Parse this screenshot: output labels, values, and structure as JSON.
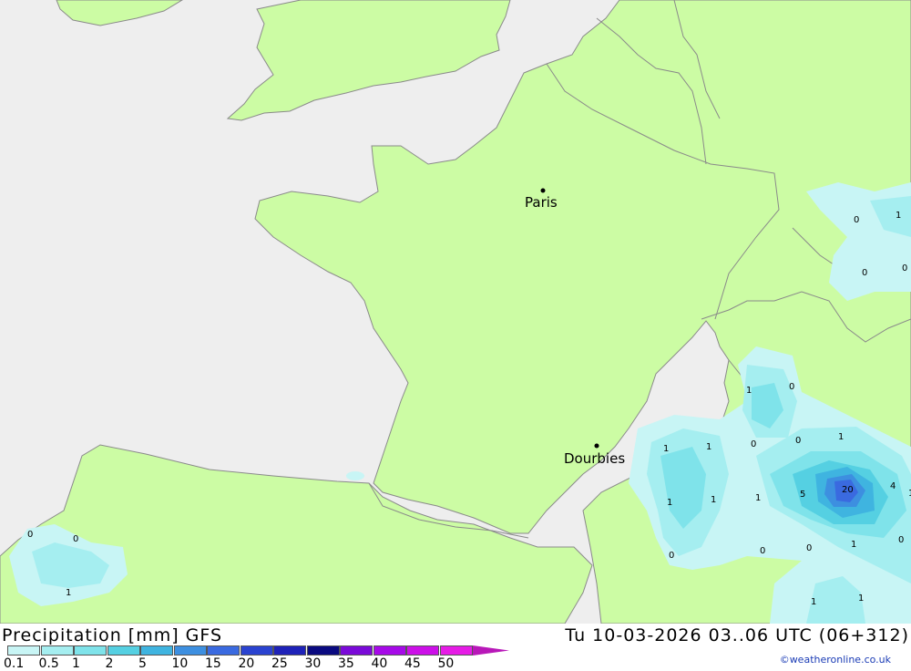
{
  "map": {
    "cities": [
      {
        "name": "Paris"
      },
      {
        "name": "Dourbies"
      }
    ],
    "values": [
      "1",
      "0",
      "0",
      "0",
      "1",
      "0",
      "0",
      "1",
      "1",
      "0",
      "1",
      "1",
      "1",
      "1",
      "1",
      "5",
      "20",
      "4",
      "0",
      "0",
      "1",
      "0",
      "0",
      "0",
      "0",
      "1",
      "1",
      "1"
    ]
  },
  "footer": {
    "title": "Precipitation [mm] GFS",
    "datetime": "Tu 10-03-2026 03..06 UTC (06+312)",
    "credit": "©weatheronline.co.uk"
  },
  "legend": {
    "labels": [
      "0.1",
      "0.5",
      "1",
      "2",
      "5",
      "10",
      "15",
      "20",
      "25",
      "30",
      "35",
      "40",
      "45",
      "50"
    ],
    "colors": [
      "#c8f5f5",
      "#a5eef0",
      "#7fe3ea",
      "#55d0e2",
      "#3fb4e0",
      "#3d8fe0",
      "#3a6ae0",
      "#2a43d0",
      "#1e22b8",
      "#0a0a80",
      "#7a0ad8",
      "#a60ae8",
      "#cc10e8",
      "#e61ce6",
      "#b818b8"
    ]
  },
  "colors": {
    "sea": "#eeeeee",
    "land": "#ccfca4",
    "border": "#999999"
  }
}
